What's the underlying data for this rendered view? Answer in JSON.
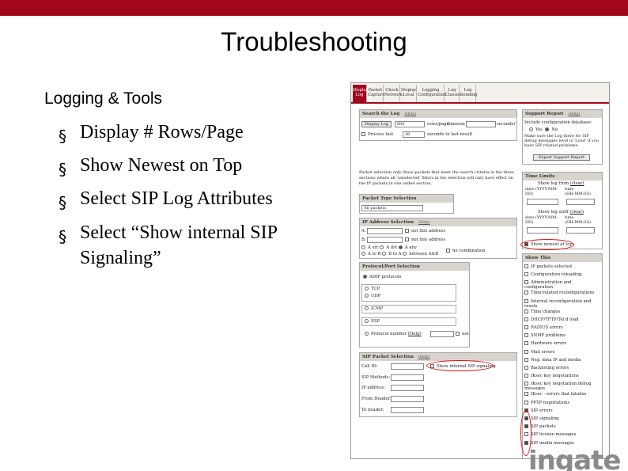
{
  "slide": {
    "title": "Troubleshooting",
    "subtitle": "Logging & Tools",
    "bullet_glyph": "§",
    "bullets": [
      "Display # Rows/Page",
      "Show Newest on Top",
      "Select SIP Log Attributes",
      "Select “Show internal SIP Signaling”"
    ],
    "accent_color": "#a0071d"
  },
  "screenshot": {
    "nav_tabs": [
      {
        "label": "Display Log",
        "active": true
      },
      {
        "label": "Packet Capture",
        "active": false
      },
      {
        "label": "Check Network",
        "active": false
      },
      {
        "label": "Display Local",
        "active": false
      },
      {
        "label": "Logging Configuration",
        "active": false
      },
      {
        "label": "Log Classes",
        "active": false
      },
      {
        "label": "Log Sending",
        "active": false
      }
    ],
    "search": {
      "title": "Search the Log",
      "help": "(Help)",
      "display_button": "Display Log",
      "rows_value": "800",
      "rows_label": "rows/page",
      "timeout_label": "(timeout",
      "seconds_label": "seconds)",
      "process_label": "Process last",
      "process_value": "30",
      "seconds_to_last_label": "seconds to last result",
      "note": "Packet selection only those packets that meet the search criteria in the three sections where all 'unselected' filters in the selection will only have effect on the IP packets in one added section."
    },
    "support": {
      "title": "Support Report",
      "help": "(Help)",
      "include_label": "Include configuration database:",
      "yes": "Yes",
      "no": "No",
      "note": "Make sure the Log there for SIP debug messages level is 'Loud' if you have SIP related problems.",
      "button": "Export Support Report"
    },
    "packet_type": {
      "title": "Packet Type Selection",
      "value": "All packets"
    },
    "ip_selection": {
      "title": "IP Address Selection",
      "help": "(Help)",
      "a_label": "A:",
      "b_label": "B:",
      "not_label": "not this address",
      "options_row1": [
        "A src",
        "A dst",
        "A any"
      ],
      "options_row2": [
        "A to B",
        "B to A",
        "between A&B"
      ],
      "combination_label": "no combination"
    },
    "protocol": {
      "title": "Protocol/Port Selection",
      "items": [
        "ADIP protocols",
        "TCP",
        "UDP",
        "ICMP",
        "ESP",
        "Protocol number"
      ],
      "help": "(Help)",
      "not_label": "not"
    },
    "sip_selection": {
      "title": "SIP Packet Selection",
      "help": "(Help)",
      "fields": [
        "Call ID:",
        "SIP Methods:",
        "IP address:",
        "From Header:",
        "To header:"
      ],
      "show_internal": "Show internal SIP signaling"
    },
    "time_limits": {
      "title": "Time Limits",
      "from_label": "Show log from",
      "clear": "(clear)",
      "date_label": "date (YYYY-MM-DD)",
      "time_label": "time (HH:MM:SS)",
      "until_label": "Show log until",
      "show_newest": "Show newest at top"
    },
    "show_this": {
      "title": "Show This",
      "items": [
        {
          "label": "IP packets selected",
          "checked": false
        },
        {
          "label": "Configuration reloading",
          "checked": false
        },
        {
          "label": "Administration and configuration",
          "checked": false
        },
        {
          "label": "Time-related reconfigurations",
          "checked": false
        },
        {
          "label": "Internal reconfiguration and resets",
          "checked": false
        },
        {
          "label": "Time changes",
          "checked": false
        },
        {
          "label": "DHCP/TFTP/Tel.d load",
          "checked": false
        },
        {
          "label": "RADIUS errors",
          "checked": false
        },
        {
          "label": "SNMP problems",
          "checked": false
        },
        {
          "label": "Hardware errors",
          "checked": false
        },
        {
          "label": "Mail errors",
          "checked": false
        },
        {
          "label": "Neg. data IP and media",
          "checked": false
        },
        {
          "label": "Backlisting errors",
          "checked": false
        },
        {
          "label": "IKsec key negotiations",
          "checked": false
        },
        {
          "label": "IKsec key negotiation debug messages",
          "checked": false
        },
        {
          "label": "IKsec - errors that fatalise",
          "checked": false
        },
        {
          "label": "PPTP negotiations",
          "checked": false
        },
        {
          "label": "SIP errors",
          "checked": true
        },
        {
          "label": "SIP signaling",
          "checked": true
        },
        {
          "label": "SIP packets",
          "checked": true
        },
        {
          "label": "SIP license messages",
          "checked": false
        },
        {
          "label": "SIP media messages",
          "checked": true
        }
      ]
    },
    "logo_text": "ingate"
  }
}
